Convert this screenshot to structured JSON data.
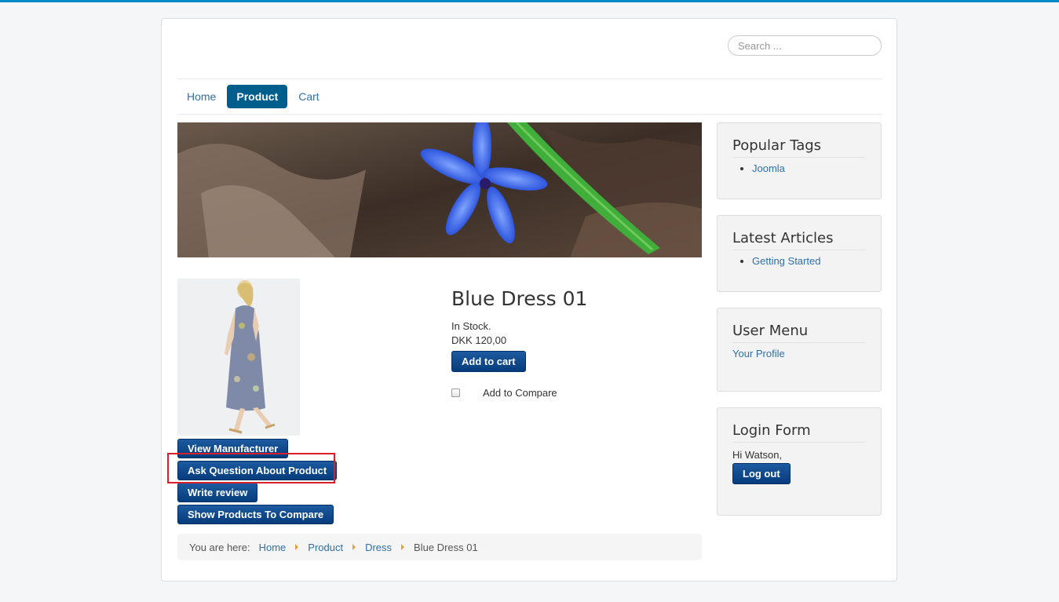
{
  "header": {
    "search_placeholder": "Search ..."
  },
  "nav": {
    "items": [
      {
        "label": "Home",
        "active": false
      },
      {
        "label": "Product",
        "active": true
      },
      {
        "label": "Cart",
        "active": false
      }
    ]
  },
  "product": {
    "title": "Blue Dress 01",
    "stock": "In Stock.",
    "price": "DKK 120,00",
    "add_to_cart": "Add to cart",
    "compare_label": "Add to Compare",
    "actions": {
      "view_manufacturer": "View Manufacturer",
      "ask_question": "Ask Question About Product",
      "write_review": "Write review",
      "show_compare": "Show Products To Compare"
    }
  },
  "breadcrumb": {
    "prefix": "You are here:",
    "items": [
      "Home",
      "Product",
      "Dress"
    ],
    "current": "Blue Dress 01"
  },
  "sidebar": {
    "popular_tags": {
      "title": "Popular Tags",
      "items": [
        "Joomla"
      ]
    },
    "latest_articles": {
      "title": "Latest Articles",
      "items": [
        "Getting Started"
      ]
    },
    "user_menu": {
      "title": "User Menu",
      "link": "Your Profile"
    },
    "login_form": {
      "title": "Login Form",
      "greeting": "Hi Watson,",
      "logout": "Log out"
    }
  },
  "colors": {
    "accent": "#005e8d",
    "button": "#0a468a",
    "link": "#2f6faa",
    "highlight": "#d9202a"
  }
}
